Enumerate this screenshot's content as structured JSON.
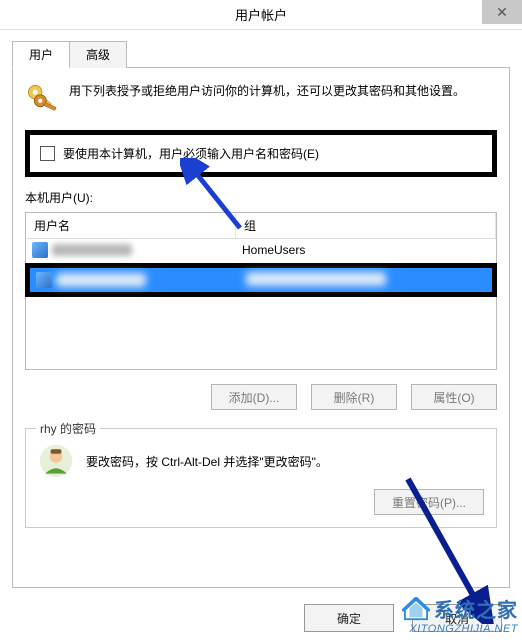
{
  "title": "用户帐户",
  "tabs": {
    "user": "用户",
    "advanced": "高级"
  },
  "intro": "用下列表授予或拒绝用户访问你的计算机，还可以更改其密码和其他设置。",
  "checkbox_label": "要使用本计算机，用户必须输入用户名和密码(E)",
  "local_users_label": "本机用户(U):",
  "columns": {
    "name": "用户名",
    "group": "组"
  },
  "rows": [
    {
      "name": "",
      "group": "HomeUsers"
    }
  ],
  "list_buttons": {
    "add": "添加(D)...",
    "remove": "删除(R)",
    "props": "属性(O)"
  },
  "password_section": {
    "legend": "rhy 的密码",
    "text": "要改密码，按 Ctrl-Alt-Del 并选择\"更改密码\"。",
    "reset": "重置密码(P)..."
  },
  "buttons": {
    "ok": "确定",
    "cancel": "取消"
  },
  "watermark": {
    "title": "系统之家",
    "url": "XITONGZHIJIA.NET"
  }
}
